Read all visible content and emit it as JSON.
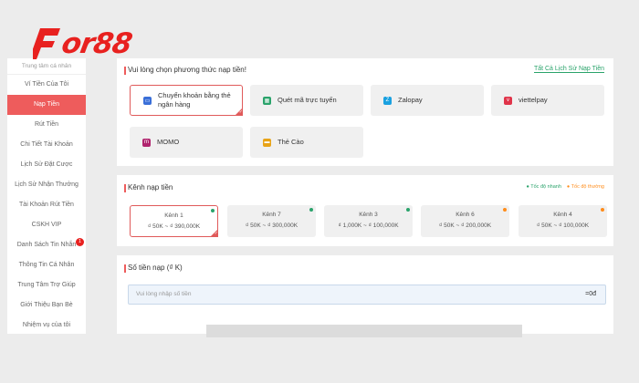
{
  "brand": {
    "logo_text": "or88",
    "logo_color": "#e8211f"
  },
  "sidebar": {
    "header": "Trung tâm cá nhân",
    "items": [
      {
        "label": "Ví Tiền Của Tôi",
        "active": false
      },
      {
        "label": "Nạp Tiền",
        "active": true
      },
      {
        "label": "Rút Tiền",
        "active": false
      },
      {
        "label": "Chi Tiết Tài Khoản",
        "active": false
      },
      {
        "label": "Lịch Sử Đặt Cược",
        "active": false
      },
      {
        "label": "Lịch Sử Nhận Thưởng",
        "active": false
      },
      {
        "label": "Tài Khoản Rút Tiền",
        "active": false
      },
      {
        "label": "CSKH VIP",
        "active": false
      },
      {
        "label": "Danh Sách Tin Nhắn",
        "active": false,
        "badge": "1"
      },
      {
        "label": "Thông Tin Cá Nhân",
        "active": false
      },
      {
        "label": "Trung Tâm Trợ Giúp",
        "active": false
      },
      {
        "label": "Giới Thiệu Bạn Bè",
        "active": false
      },
      {
        "label": "Nhiệm vụ của tôi",
        "active": false
      }
    ]
  },
  "methods": {
    "title": "Vui lòng chọn phương thức nạp tiền!",
    "history_link": "Tất Cả Lịch Sử Nạp Tiền",
    "items": [
      {
        "label_line1": "Chuyển khoản bằng thẻ",
        "label_line2": "ngân hàng",
        "icon": "bank-card-icon",
        "selected": true
      },
      {
        "label_line1": "Quét mã trực tuyến",
        "label_line2": "",
        "icon": "qr-icon",
        "selected": false
      },
      {
        "label_line1": "Zalopay",
        "label_line2": "",
        "icon": "zalopay-icon",
        "selected": false
      },
      {
        "label_line1": "viettelpay",
        "label_line2": "",
        "icon": "viettelpay-icon",
        "selected": false
      },
      {
        "label_line1": "MOMO",
        "label_line2": "",
        "icon": "momo-icon",
        "selected": false
      },
      {
        "label_line1": "Thẻ Cào",
        "label_line2": "",
        "icon": "scratch-card-icon",
        "selected": false
      }
    ]
  },
  "channels": {
    "title": "Kênh nạp tiền",
    "legend_fast": "● Tốc độ nhanh",
    "legend_normal": "● Tốc độ thường",
    "items": [
      {
        "name": "Kênh 1",
        "range": "₫ 50K ~ ₫ 390,000K",
        "speed": "fast",
        "selected": true
      },
      {
        "name": "Kênh 7",
        "range": "₫ 50K ~ ₫ 300,000K",
        "speed": "fast",
        "selected": false
      },
      {
        "name": "Kênh 3",
        "range": "₫ 1,000K ~ ₫ 100,000K",
        "speed": "fast",
        "selected": false
      },
      {
        "name": "Kênh 6",
        "range": "₫ 50K ~ ₫ 200,000K",
        "speed": "normal",
        "selected": false
      },
      {
        "name": "Kênh 4",
        "range": "₫ 50K ~ ₫ 100,000K",
        "speed": "normal",
        "selected": false
      }
    ]
  },
  "amount": {
    "title": "Số tiền nạp  (₫ K)",
    "placeholder": "Vui lòng nhập số tiền",
    "equals": "=0đ"
  },
  "colors": {
    "accent": "#e05a5a",
    "fast": "#2aa36b",
    "normal": "#ff8c1a"
  }
}
